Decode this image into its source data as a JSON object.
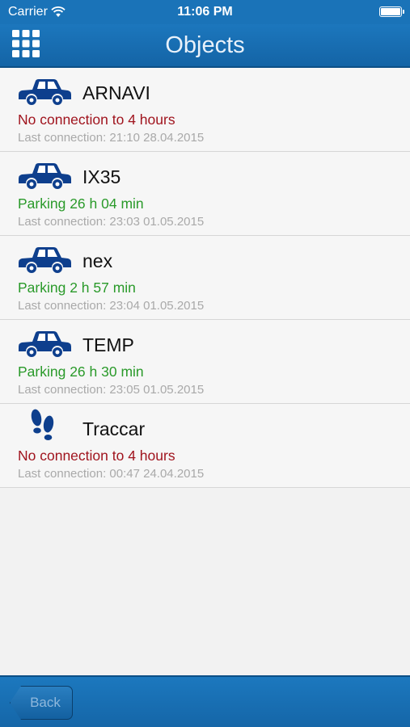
{
  "status_bar": {
    "carrier": "Carrier",
    "time": "11:06 PM",
    "battery_level": 1.0
  },
  "nav": {
    "title": "Objects",
    "menu_icon": "grid-icon"
  },
  "colors": {
    "accent": "#1a73b8",
    "offline": "#a0141e",
    "parking": "#2a9a2a",
    "icon": "#0e3f8d"
  },
  "objects": [
    {
      "name": "ARNAVI",
      "icon": "car-icon",
      "status": "No connection to 4 hours",
      "status_type": "offline",
      "last": "Last connection: 21:10 28.04.2015"
    },
    {
      "name": "IX35",
      "icon": "car-icon",
      "status": "Parking 26 h 04 min",
      "status_type": "parking",
      "last": "Last connection: 23:03 01.05.2015"
    },
    {
      "name": "nex",
      "icon": "car-icon",
      "status": "Parking 2 h 57 min",
      "status_type": "parking",
      "last": "Last connection: 23:04 01.05.2015"
    },
    {
      "name": "TEMP",
      "icon": "car-icon",
      "status": "Parking 26 h 30 min",
      "status_type": "parking",
      "last": "Last connection: 23:05 01.05.2015"
    },
    {
      "name": "Traccar",
      "icon": "footprints-icon",
      "status": "No connection to 4 hours",
      "status_type": "offline",
      "last": "Last connection: 00:47 24.04.2015"
    }
  ],
  "bottom": {
    "back_label": "Back"
  }
}
